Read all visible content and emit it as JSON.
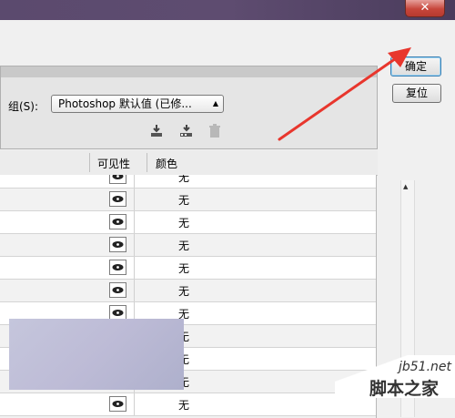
{
  "window": {
    "close_label": "✕"
  },
  "buttons": {
    "ok_label": "确定",
    "reset_label": "复位"
  },
  "group": {
    "label": "组(S):",
    "selected": "Photoshop 默认值 (已修..."
  },
  "toolbar": {
    "icons": [
      "save-set-icon",
      "new-set-icon",
      "delete-icon"
    ]
  },
  "table": {
    "headers": {
      "visibility": "可见性",
      "color": "颜色"
    },
    "rows": [
      {
        "color": "无"
      },
      {
        "color": "无"
      },
      {
        "color": "无"
      },
      {
        "color": "无"
      },
      {
        "color": "无"
      },
      {
        "color": "无"
      },
      {
        "color": "无"
      },
      {
        "color": "无"
      },
      {
        "color": "无"
      },
      {
        "color": "无"
      },
      {
        "color": "无"
      }
    ]
  },
  "watermark": {
    "url": "jb51.net",
    "text": "脚本之家"
  },
  "colors": {
    "titlebar": "#5b4a6e",
    "close": "#c7463b",
    "annotation_arrow": "#e8362d"
  }
}
